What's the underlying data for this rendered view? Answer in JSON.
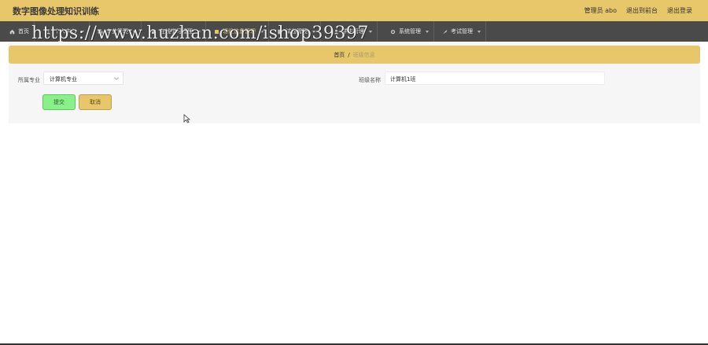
{
  "app": {
    "title": "数字图像处理知识训练"
  },
  "header_actions": [
    "管理员 abo",
    "退出到前台",
    "退出登录"
  ],
  "nav": [
    {
      "label": "首页",
      "icon": "home-icon"
    },
    {
      "label": "个人中心",
      "icon": "user-icon"
    },
    {
      "label": "专业管理",
      "icon": "folder-icon"
    },
    {
      "label": "在线学习管理",
      "icon": "book-icon"
    },
    {
      "label": "班级信息管理",
      "icon": "class-icon"
    },
    {
      "label": "试卷管理",
      "icon": "paper-icon"
    },
    {
      "label": "学生管理",
      "icon": "student-icon"
    },
    {
      "label": "系统管理",
      "icon": "gear-icon"
    },
    {
      "label": "考试管理",
      "icon": "exam-icon"
    }
  ],
  "watermark": "https://www.huzhan.com/ishop39397",
  "breadcrumb": {
    "home": "首页",
    "separator": "/",
    "current": "班级信息"
  },
  "form": {
    "major_label": "所属专业",
    "major_value": "计算机专业",
    "class_label": "班级名称",
    "class_value": "计算机1班",
    "submit_label": "提交",
    "cancel_label": "取消"
  }
}
